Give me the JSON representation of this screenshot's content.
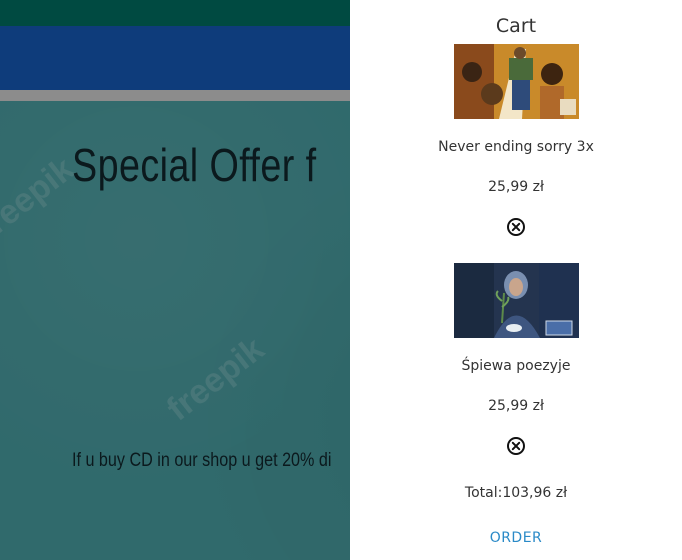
{
  "hero": {
    "title": "Special Offer f",
    "text": "If u buy CD in our shop u get 20% di",
    "watermark": "freepik"
  },
  "cart": {
    "title": "Cart",
    "items": [
      {
        "name": "Never ending sorry 3x",
        "price": "25,99 zł",
        "remove_icon": "close-circle-icon"
      },
      {
        "name": "Śpiewa poezyje",
        "price": "25,99 zł",
        "remove_icon": "close-circle-icon"
      }
    ],
    "total": "Total:103,96 zł",
    "order_label": "ORDER"
  },
  "colors": {
    "top_bar": "#006b5e",
    "nav_bar": "#1557b0",
    "hero_bg": "#46989b",
    "order_link": "#2a8ac7"
  }
}
